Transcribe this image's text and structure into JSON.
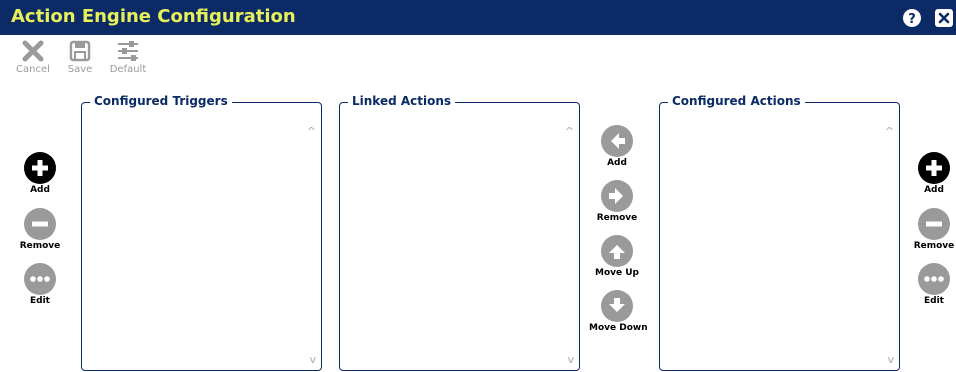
{
  "window": {
    "title": "Action Engine Configuration"
  },
  "toolbar": {
    "cancel_label": "Cancel",
    "save_label": "Save",
    "default_label": "Default"
  },
  "panels": {
    "triggers_title": "Configured Triggers",
    "linked_title": "Linked Actions",
    "actions_title": "Configured Actions"
  },
  "left_controls": {
    "add": "Add",
    "remove": "Remove",
    "edit": "Edit"
  },
  "middle_controls": {
    "add": "Add",
    "remove": "Remove",
    "move_up": "Move Up",
    "move_down": "Move Down"
  },
  "right_controls": {
    "add": "Add",
    "remove": "Remove",
    "edit": "Edit"
  },
  "scroll": {
    "up": "^",
    "down": "v"
  },
  "colors": {
    "titlebar": "#0b2a66",
    "title_text": "#e8f15a",
    "disabled_icon": "#9a9a9a",
    "active_icon": "#000000"
  }
}
